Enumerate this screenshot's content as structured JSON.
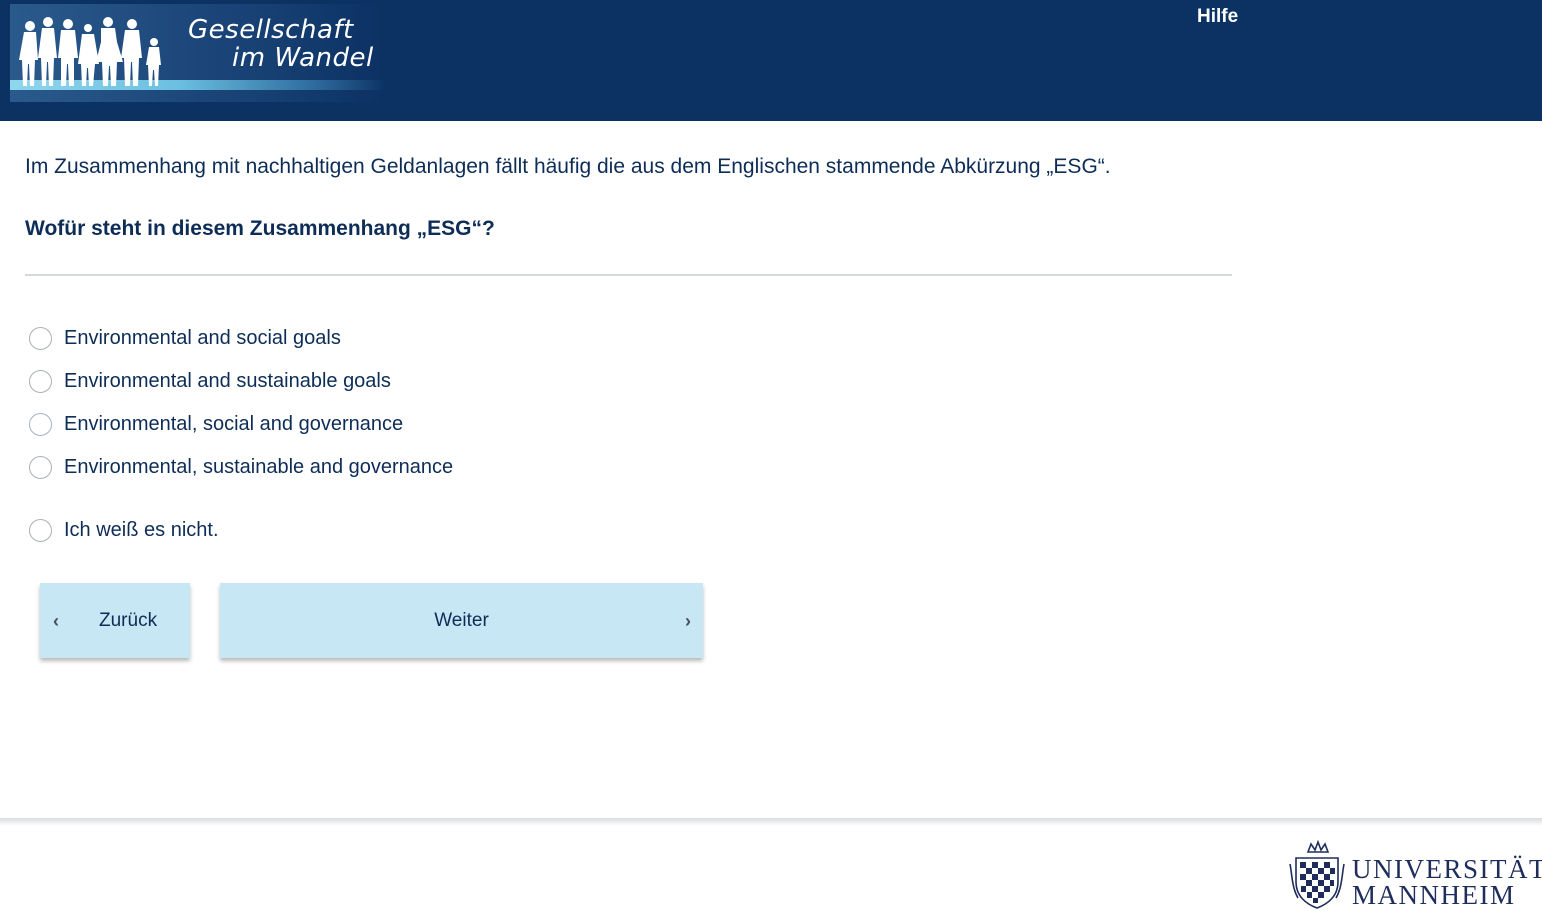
{
  "header": {
    "logo": {
      "line1": "Gesellschaft",
      "line2": "im Wandel"
    },
    "help_link": "Hilfe"
  },
  "survey": {
    "intro": "Im Zusammenhang mit nachhaltigen Geldanlagen fällt häufig die aus dem Englischen stammende Abkürzung „ESG“.",
    "question": "Wofür steht in diesem Zusammenhang „ESG“?",
    "options": [
      {
        "label": "Environmental and social goals",
        "selected": false
      },
      {
        "label": "Environmental and sustainable goals",
        "selected": false
      },
      {
        "label": "Environmental, social and governance",
        "selected": false
      },
      {
        "label": "Environmental, sustainable and governance",
        "selected": false
      },
      {
        "label": "Ich weiß es nicht.",
        "selected": false
      }
    ]
  },
  "navigation": {
    "back_label": "Zurück",
    "next_label": "Weiter",
    "back_icon": "chevron-left-icon",
    "next_icon": "chevron-right-icon"
  },
  "footer": {
    "university_line1": "UNIVERSITÄT",
    "university_line2": "MANNHEIM"
  },
  "colors": {
    "header_bg": "#0c3163",
    "text": "#0d2d57",
    "button_bg": "#c7e7f4",
    "radio_border": "#a9b0b8"
  }
}
